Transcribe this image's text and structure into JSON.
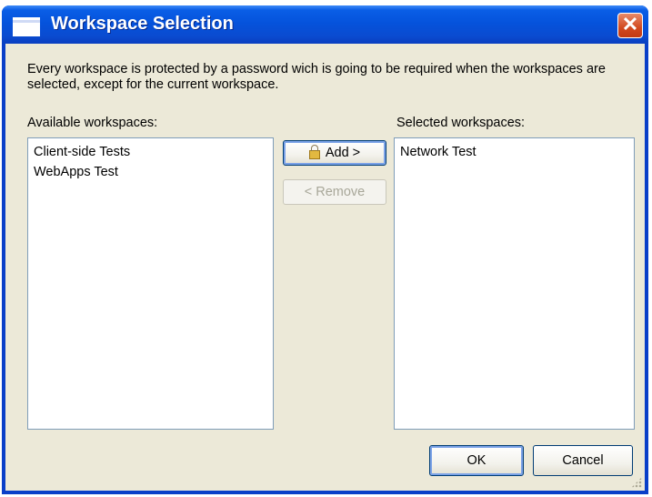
{
  "window": {
    "title": "Workspace Selection",
    "close_glyph": "✕"
  },
  "description": "Every workspace is protected by a password wich is going to be required when the workspaces are selected, except for the current workspace.",
  "available": {
    "label": "Available workspaces:",
    "items": [
      "Client-side Tests",
      "WebApps Test"
    ]
  },
  "selected": {
    "label": "Selected workspaces:",
    "items": [
      "Network Test"
    ]
  },
  "buttons": {
    "add": "Add >",
    "remove": "< Remove",
    "ok": "OK",
    "cancel": "Cancel"
  },
  "icons": {
    "app": "window-icon",
    "add": "lock-icon",
    "resize": "resize-grip-icon"
  },
  "colors": {
    "titlebar": "#0553dc",
    "dialog_face": "#ece9d8",
    "close_button": "#d2491f"
  }
}
